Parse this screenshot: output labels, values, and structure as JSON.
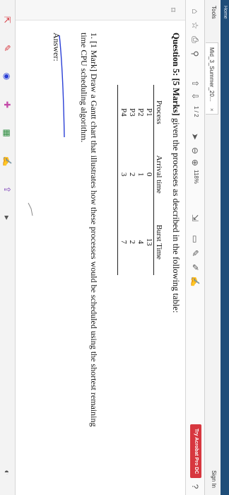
{
  "window": {
    "title": "Home",
    "menu_tools": "Tools",
    "tab_label": "Mid_3_Summer_20...",
    "tab_close": "×",
    "signin": "Sign In"
  },
  "toolbar": {
    "page": "1 / 2",
    "zoom": "118%",
    "try_acrobat": "Try Acrobat Pro DC"
  },
  "question": {
    "heading": "Question 5: [5 Marks]",
    "intro": " given the processes as described in the following table:"
  },
  "table": {
    "headers": [
      "Process",
      "Arrival time",
      "Burst Time"
    ],
    "rows": [
      [
        "P1",
        "0",
        "13"
      ],
      [
        "P2",
        "1",
        "4"
      ],
      [
        "P3",
        "2",
        "2"
      ],
      [
        "P4",
        "3",
        "7"
      ]
    ]
  },
  "part1": "1. [1 Mark] Draw a Gantt chart that illustrates how these processes would be scheduled using the shortest remaining time CPU scheduling algorithm.",
  "answer_label": "Answer:",
  "colors": {
    "ink_pen": "#2a3fd6",
    "adobe_red": "#d7373f",
    "title_bar": "#1f4e79"
  },
  "icons": [
    "home-icon",
    "star-icon",
    "print-icon",
    "search-icon",
    "page-up-icon",
    "page-down-icon",
    "cursor-icon",
    "zoom-out-icon",
    "zoom-in-icon",
    "save-icon",
    "share-icon",
    "sign-icon",
    "comment-icon",
    "pen-icon",
    "highlight-icon",
    "sidebar-icon"
  ]
}
